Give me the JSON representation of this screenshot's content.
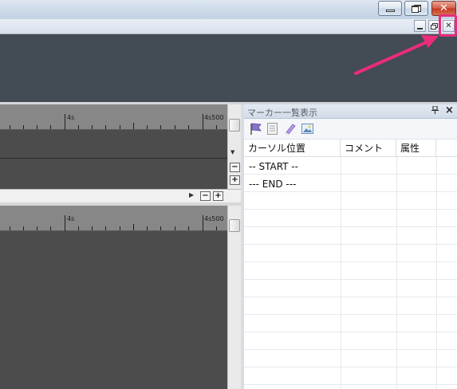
{
  "outer_window": {
    "buttons": [
      "minimize",
      "maximize",
      "close"
    ],
    "close_color": "#c4391f"
  },
  "mdi_controls": {
    "buttons": [
      "minimize",
      "restore",
      "close"
    ]
  },
  "annotation": {
    "color": "#ea2c7a"
  },
  "timeline": {
    "ruler_labels": [
      "4s",
      "4s500"
    ],
    "track_bg": "#4c4c4c",
    "ruler_bg": "#878787"
  },
  "zoom_controls": {
    "minus": "−",
    "plus": "+"
  },
  "marker_panel": {
    "title": "マーカー一覧表示",
    "pin_icon": "ᵖ",
    "close_icon": "×",
    "toolbar_icons": [
      "flag-icon",
      "list-icon",
      "eraser-icon",
      "image-icon"
    ],
    "columns": [
      "カーソル位置",
      "コメント",
      "属性"
    ],
    "rows": [
      {
        "position": "-- START --",
        "comment": "",
        "attribute": ""
      },
      {
        "position": "--- END ---",
        "comment": "",
        "attribute": ""
      }
    ]
  }
}
